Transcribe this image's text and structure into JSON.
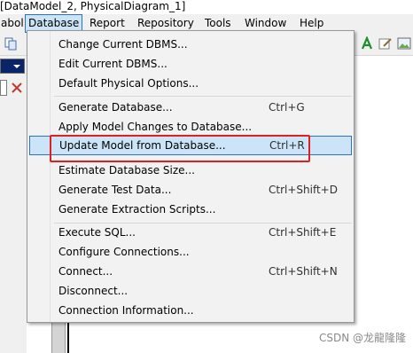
{
  "title_text": "[DataModel_2, PhysicalDiagram_1]",
  "menubar": {
    "items": [
      "abol",
      "Database",
      "Report",
      "Repository",
      "Tools",
      "Window",
      "Help"
    ],
    "active": "Database"
  },
  "database_menu": {
    "items": [
      {
        "label": "Change Current DBMS...",
        "shortcut": ""
      },
      {
        "label": "Edit Current DBMS...",
        "shortcut": ""
      },
      {
        "label": "Default Physical Options...",
        "shortcut": ""
      },
      {
        "label": "Generate Database...",
        "shortcut": "Ctrl+G"
      },
      {
        "label": "Apply Model Changes to Database...",
        "shortcut": ""
      },
      {
        "label": "Update Model from Database...",
        "shortcut": "Ctrl+R"
      },
      {
        "label": "Estimate Database Size...",
        "shortcut": ""
      },
      {
        "label": "Generate Test Data...",
        "shortcut": "Ctrl+Shift+D"
      },
      {
        "label": "Generate Extraction Scripts...",
        "shortcut": ""
      },
      {
        "label": "Execute SQL...",
        "shortcut": "Ctrl+Shift+E"
      },
      {
        "label": "Configure Connections...",
        "shortcut": ""
      },
      {
        "label": "Connect...",
        "shortcut": "Ctrl+Shift+N"
      },
      {
        "label": "Disconnect...",
        "shortcut": ""
      },
      {
        "label": "Connection Information...",
        "shortcut": ""
      }
    ],
    "highlighted": "Update Model from Database..."
  },
  "watermark": "CSDN @龙龍隆隆",
  "colors": {
    "menu_highlight": "#cce4f7",
    "highlight_border": "#2b72c2",
    "annotation_red": "#e02020",
    "combo_blue": "#0a246a"
  },
  "icons": [
    "copy-icon",
    "text-a-icon",
    "edit-icon",
    "picture-icon",
    "filter-clear-icon",
    "chevron-down-icon"
  ]
}
